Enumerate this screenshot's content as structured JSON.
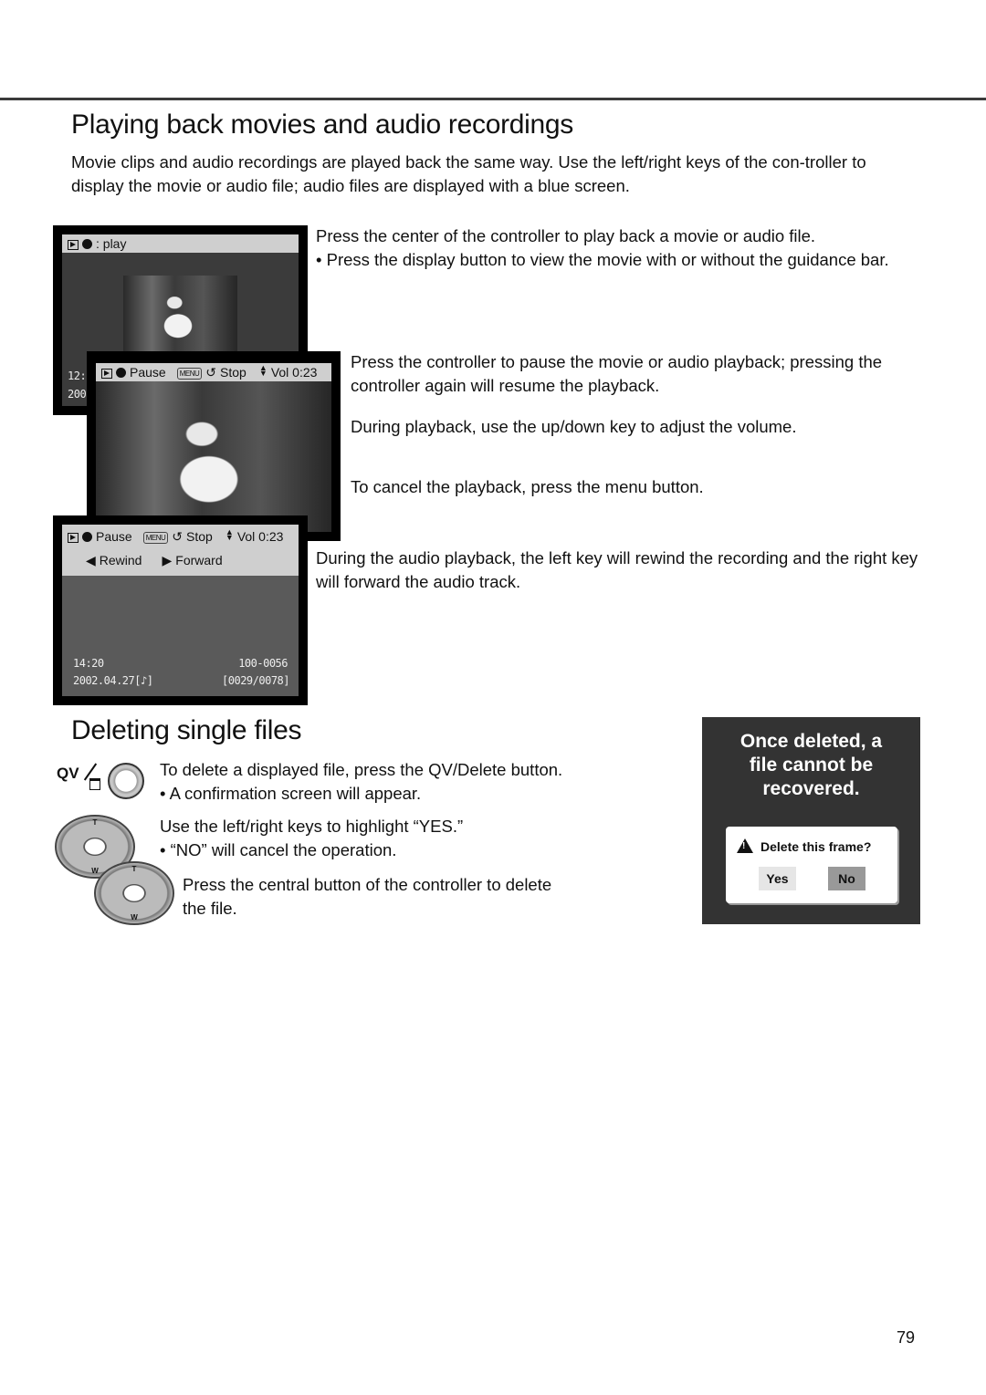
{
  "section1": {
    "title": "Playing back movies and audio recordings",
    "intro": "Movie clips and audio recordings are played back the same way. Use the left/right keys of the con-troller to display the movie or audio file; audio files are displayed with a blue screen.",
    "steps": [
      "Press the center of the controller to play back a movie or audio file.",
      "• Press the display button to view the movie with or without the guidance bar.",
      "Press the controller to pause the movie or audio playback; pressing the controller again will resume the playback.",
      "During playback, use the up/down key to adjust the volume.",
      "To cancel the playback, press the menu button.",
      "During the audio playback, the left key will rewind the recording and the right key will forward the audio track."
    ],
    "screen1": {
      "bar": ": play",
      "time_partial": "12:",
      "date_partial": "200"
    },
    "screen2": {
      "pause": "Pause",
      "menu": "MENU",
      "stop": "Stop",
      "vol": "Vol 0:23"
    },
    "screen3": {
      "pause": "Pause",
      "menu": "MENU",
      "stop": "Stop",
      "vol": "Vol 0:23",
      "rewind": "Rewind",
      "forward": "Forward",
      "time": "14:20",
      "file": "100-0056",
      "date": "2002.04.27[♪]",
      "counter": "[0029/0078]"
    }
  },
  "section2": {
    "title": "Deleting single files",
    "qv_label": "QV",
    "steps": [
      "To delete a displayed file, press the QV/Delete button.",
      "• A confirmation screen will appear.",
      "Use the left/right keys to highlight “YES.”",
      "• “NO” will cancel the operation.",
      "Press the central button of the controller to delete the file."
    ],
    "controller": {
      "t": "T",
      "w": "W"
    },
    "warning": {
      "title": "Once deleted, a file cannot be recovered.",
      "dialog": "Delete this frame?",
      "yes": "Yes",
      "no": "No"
    }
  },
  "page_number": "79"
}
